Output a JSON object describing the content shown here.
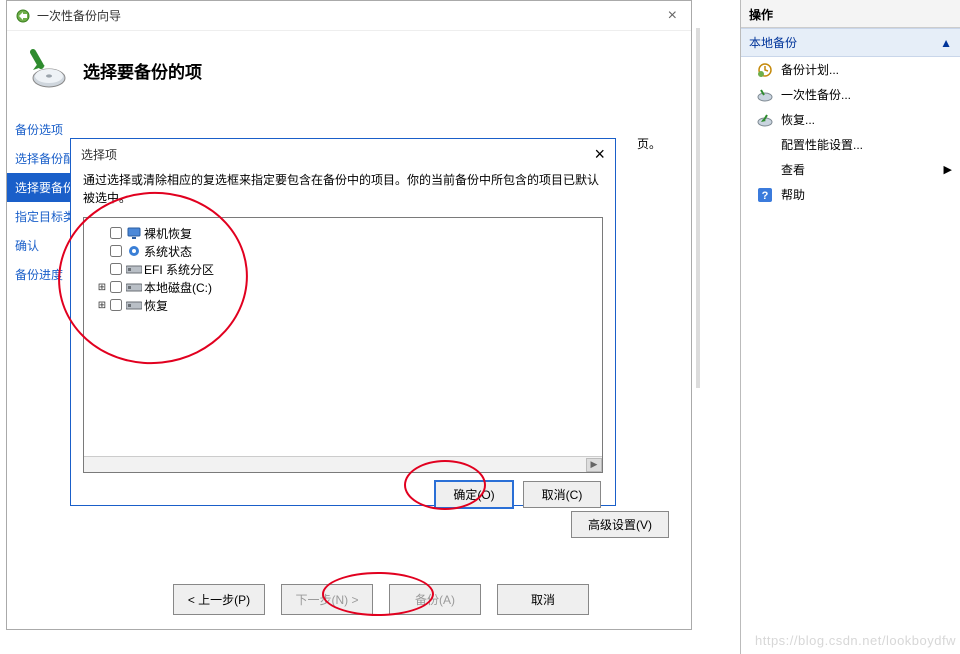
{
  "wizard": {
    "window_title": "一次性备份向导",
    "page_title": "选择要备份的项",
    "close_glyph": "×",
    "steps": [
      "备份选项",
      "选择备份配置",
      "选择要备份的项",
      "指定目标类型",
      "确认",
      "备份进度"
    ],
    "advanced_settings_label": "高级设置(V)",
    "footer": {
      "prev": "< 上一步(P)",
      "next": "下一步(N) >",
      "backup": "备份(A)",
      "cancel": "取消"
    }
  },
  "dialog": {
    "title": "选择项",
    "close_glyph": "×",
    "description": "通过选择或清除相应的复选框来指定要包含在备份中的项目。你的当前备份中所包含的项目已默认被选中。",
    "tree": [
      {
        "label": "裸机恢复",
        "expander": "",
        "icon": "monitor",
        "checked": false
      },
      {
        "label": "系统状态",
        "expander": "",
        "icon": "gear",
        "checked": false
      },
      {
        "label": "EFI 系统分区",
        "expander": "",
        "icon": "drive",
        "checked": false
      },
      {
        "label": "本地磁盘(C:)",
        "expander": "⊞",
        "icon": "drive",
        "checked": false
      },
      {
        "label": "恢复",
        "expander": "⊞",
        "icon": "drive",
        "checked": false
      }
    ],
    "scroll_glyph": "▶",
    "ok_label": "确定(O)",
    "cancel_label": "取消(C)"
  },
  "task_pane": {
    "header": "操作",
    "section": "本地备份",
    "collapse_glyph": "▲",
    "view_arrow": "▶",
    "items": [
      {
        "label": "备份计划...",
        "icon": "clock",
        "indent": false
      },
      {
        "label": "一次性备份...",
        "icon": "disc",
        "indent": false
      },
      {
        "label": "恢复...",
        "icon": "recover",
        "indent": false
      },
      {
        "label": "配置性能设置...",
        "icon": "",
        "indent": true
      },
      {
        "label": "查看",
        "icon": "",
        "indent": true,
        "has_arrow": true
      },
      {
        "label": "帮助",
        "icon": "help",
        "indent": false
      }
    ]
  },
  "watermark": "https://blog.csdn.net/lookboydfw",
  "extra_text": "页。"
}
